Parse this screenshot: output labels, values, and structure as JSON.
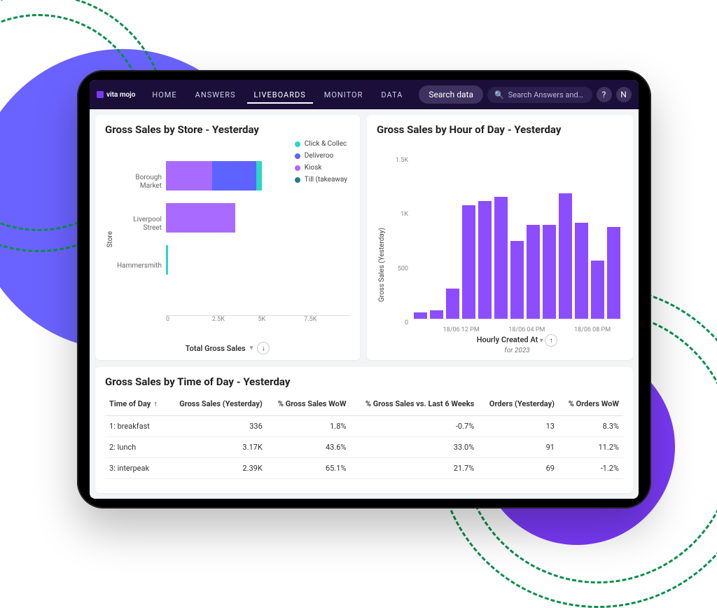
{
  "brand": "vita mojo",
  "nav": {
    "items": [
      "HOME",
      "ANSWERS",
      "LIVEBOARDS",
      "MONITOR",
      "DATA"
    ],
    "active_index": 2,
    "search_pill": "Search data",
    "search_ans_placeholder": "Search Answers and…",
    "help_label": "?",
    "avatar_letter": "N"
  },
  "colors": {
    "click_collect": "#2ad7c6",
    "deliveroo": "#5e63ff",
    "kiosk": "#a96bff",
    "till": "#1d7f8c",
    "bar": "#8b4dff"
  },
  "store_card": {
    "title": "Gross Sales by Store - Yesterday",
    "y_axis_title": "Store",
    "x_axis_label": "Total Gross Sales",
    "sort_dir": "↓",
    "legend": [
      {
        "key": "click_collect",
        "label": "Click & Collec"
      },
      {
        "key": "deliveroo",
        "label": "Deliveroo"
      },
      {
        "key": "kiosk",
        "label": "Kiosk"
      },
      {
        "key": "till",
        "label": "Till (takeaway"
      }
    ],
    "x_ticks": [
      "0",
      "2.5K",
      "5K",
      "7.5K"
    ]
  },
  "hour_card": {
    "title": "Gross Sales by Hour of Day - Yesterday",
    "y_axis_title": "Gross Sales (Yesterday)",
    "y_ticks": [
      "1.5K",
      "1K",
      "500",
      "0"
    ],
    "x_axis_label": "Hourly Created At",
    "x_axis_sub": "for 2023",
    "sort_dir": "↑",
    "x_tick_labels": [
      "18/06 12 PM",
      "18/06 04 PM",
      "18/06 08 PM"
    ]
  },
  "table_card": {
    "title": "Gross Sales by Time of Day - Yesterday",
    "columns": [
      "Time of Day",
      "Gross Sales (Yesterday)",
      "% Gross Sales WoW",
      "% Gross Sales vs. Last 6 Weeks",
      "Orders (Yesterday)",
      "% Orders WoW"
    ],
    "sort_col": 0,
    "sort_dir": "↑",
    "rows": [
      {
        "tod": "1: breakfast",
        "gross": "336",
        "wow": "1.8%",
        "l6w": "-0.7%",
        "orders": "13",
        "owow": "8.3%"
      },
      {
        "tod": "2: lunch",
        "gross": "3.17K",
        "wow": "43.6%",
        "l6w": "33.0%",
        "orders": "91",
        "owow": "11.2%"
      },
      {
        "tod": "3: interpeak",
        "gross": "2.39K",
        "wow": "65.1%",
        "l6w": "21.7%",
        "orders": "69",
        "owow": "-1.2%"
      }
    ]
  },
  "chart_data": [
    {
      "type": "bar",
      "orientation": "horizontal-stacked",
      "title": "Gross Sales by Store - Yesterday",
      "xlabel": "Total Gross Sales",
      "ylabel": "Store",
      "xlim": [
        0,
        7500
      ],
      "categories": [
        "Borough Market",
        "Liverpool Street",
        "Hammersmith"
      ],
      "series": [
        {
          "name": "Kiosk",
          "color": "#a96bff",
          "values": [
            2600,
            3900,
            0
          ]
        },
        {
          "name": "Deliveroo",
          "color": "#5e63ff",
          "values": [
            2500,
            0,
            0
          ]
        },
        {
          "name": "Click & Collect",
          "color": "#2ad7c6",
          "values": [
            300,
            0,
            100
          ]
        },
        {
          "name": "Till (takeaway)",
          "color": "#1d7f8c",
          "values": [
            0,
            0,
            0
          ]
        }
      ]
    },
    {
      "type": "bar",
      "title": "Gross Sales by Hour of Day - Yesterday",
      "xlabel": "Hourly Created At (for 2023)",
      "ylabel": "Gross Sales (Yesterday)",
      "ylim": [
        0,
        1500
      ],
      "categories": [
        "18/06 09 AM",
        "18/06 10 AM",
        "18/06 11 AM",
        "18/06 12 PM",
        "18/06 01 PM",
        "18/06 02 PM",
        "18/06 03 PM",
        "18/06 04 PM",
        "18/06 05 PM",
        "18/06 06 PM",
        "18/06 07 PM",
        "18/06 08 PM",
        "18/06 09 PM"
      ],
      "values": [
        60,
        80,
        280,
        1050,
        1090,
        1130,
        720,
        870,
        870,
        1160,
        890,
        540,
        850
      ]
    },
    {
      "type": "table",
      "title": "Gross Sales by Time of Day - Yesterday",
      "columns": [
        "Time of Day",
        "Gross Sales (Yesterday)",
        "% Gross Sales WoW",
        "% Gross Sales vs. Last 6 Weeks",
        "Orders (Yesterday)",
        "% Orders WoW"
      ],
      "rows": [
        [
          "1: breakfast",
          336,
          1.8,
          -0.7,
          13,
          8.3
        ],
        [
          "2: lunch",
          3170,
          43.6,
          33.0,
          91,
          11.2
        ],
        [
          "3: interpeak",
          2390,
          65.1,
          21.7,
          69,
          -1.2
        ]
      ]
    }
  ]
}
